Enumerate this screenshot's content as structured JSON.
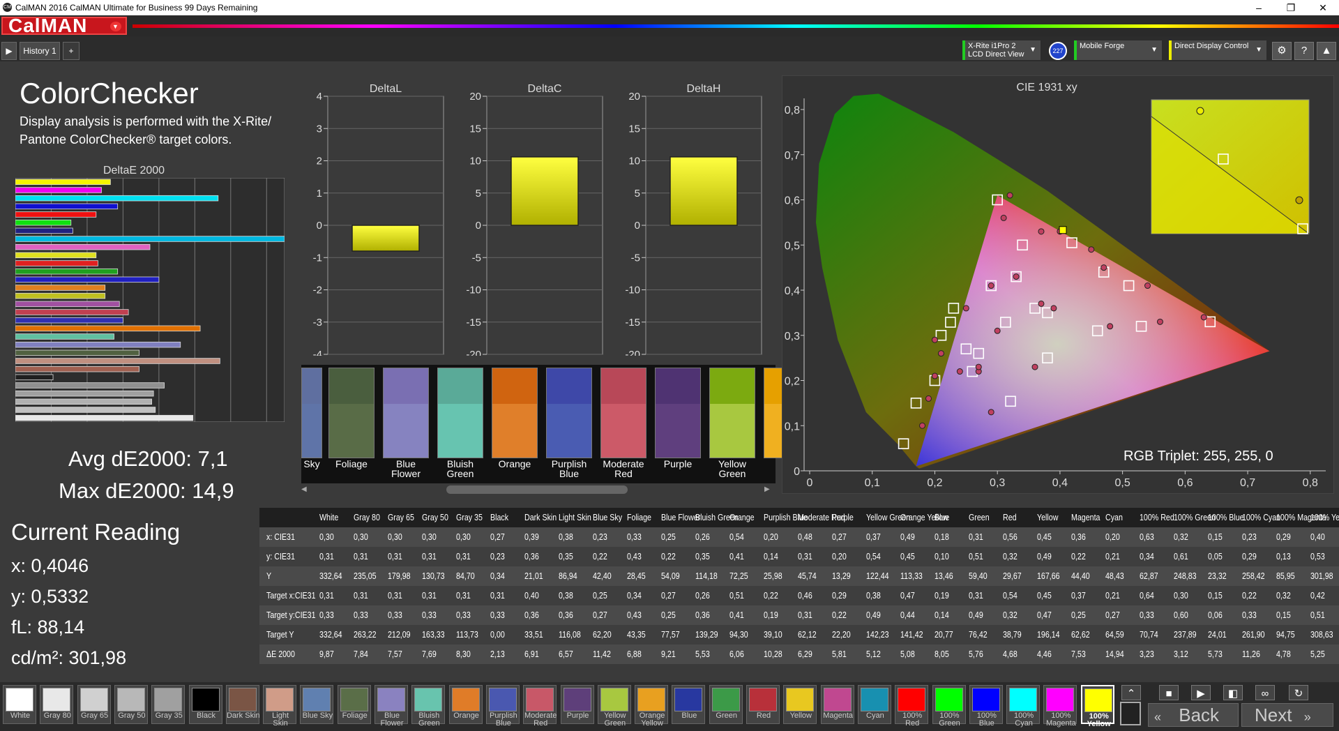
{
  "window": {
    "title": "CalMAN 2016 CalMAN Ultimate for Business 99 Days Remaining",
    "logo": "CM",
    "min": "–",
    "max": "❐",
    "close": "✕"
  },
  "brand": {
    "name": "CalMAN"
  },
  "tabs": [
    {
      "label": "History 1"
    },
    {
      "label": "+"
    }
  ],
  "devices": {
    "meter": "X-Rite i1Pro 2",
    "meter_mode": "LCD Direct View",
    "meter_badge": "227",
    "source": "Mobile Forge",
    "display": "Direct Display Control"
  },
  "colorchecker": {
    "title": "ColorChecker",
    "desc1": "Display analysis is performed with the X-Rite/",
    "desc2": "Pantone ColorChecker® target colors.",
    "chart_title": "DeltaE 2000",
    "avg": "Avg dE2000: 7,1",
    "max": "Max dE2000: 14,9"
  },
  "current": {
    "title": "Current Reading",
    "x": "x: 0,4046",
    "y": "y: 0,5332",
    "fL": "fL: 88,14",
    "cdm2": "cd/m²: 301,98"
  },
  "mini_titles": [
    "DeltaL",
    "DeltaC",
    "DeltaH"
  ],
  "cie": {
    "title": "CIE 1931 xy",
    "triplet": "RGB Triplet: 255, 255, 0"
  },
  "navigation": {
    "back": "Back",
    "next": "Next"
  },
  "chart_data": [
    {
      "type": "bar",
      "title": "DeltaE 2000",
      "orientation": "horizontal",
      "xlim": [
        0,
        15
      ],
      "xticks": [
        "0",
        "2",
        "4",
        "6",
        "8",
        "10",
        "12",
        "14"
      ],
      "colors": [
        "#f4f400",
        "#f000f0",
        "#00e0f0",
        "#1010d0",
        "#f01010",
        "#10e010",
        "#202080",
        "#00b8e0",
        "#e060c0",
        "#e0e020",
        "#e02020",
        "#20a020",
        "#2020c0",
        "#e08020",
        "#c0c020",
        "#a050a0",
        "#c04050",
        "#3030b0",
        "#e07000",
        "#60c0a0",
        "#8080c0",
        "#506040",
        "#c09080",
        "#a06050",
        "#202020",
        "#909090",
        "#a0a0a0",
        "#b0b0b0",
        "#c0c0c0",
        "#e8e8e8"
      ],
      "values": [
        5.3,
        4.8,
        11.3,
        5.7,
        4.5,
        3.1,
        3.2,
        15.0,
        7.5,
        4.5,
        4.6,
        5.7,
        8.0,
        5.0,
        5.0,
        5.8,
        6.3,
        6.0,
        10.3,
        5.5,
        9.2,
        6.9,
        11.4,
        6.9,
        2.1,
        8.3,
        7.7,
        7.6,
        7.8,
        9.9
      ]
    },
    {
      "type": "bar",
      "title": "DeltaL",
      "ylim": [
        -4,
        4
      ],
      "yticks": [
        "4",
        "3",
        "2",
        "1",
        "0",
        "-1",
        "-2",
        "-3",
        "-4"
      ],
      "values": [
        -0.8
      ]
    },
    {
      "type": "bar",
      "title": "DeltaC",
      "ylim": [
        -20,
        20
      ],
      "yticks": [
        "20",
        "15",
        "10",
        "5",
        "0",
        "-5",
        "-10",
        "-15",
        "-20"
      ],
      "values": [
        10.6
      ]
    },
    {
      "type": "bar",
      "title": "DeltaH",
      "ylim": [
        -20,
        20
      ],
      "yticks": [
        "20",
        "15",
        "10",
        "5",
        "0",
        "-5",
        "-10",
        "-15",
        "-20"
      ],
      "values": [
        10.6
      ]
    },
    {
      "type": "scatter",
      "title": "CIE 1931 xy",
      "xlim": [
        0,
        0.8
      ],
      "ylim": [
        0,
        0.8
      ],
      "xticks": [
        "0",
        "0,1",
        "0,2",
        "0,3",
        "0,4",
        "0,5",
        "0,6",
        "0,7",
        "0,8"
      ],
      "yticks": [
        "0,8",
        "0,7",
        "0,6",
        "0,5",
        "0,4",
        "0,3",
        "0,2",
        "0,1",
        "0"
      ],
      "gamut": [
        [
          0.64,
          0.33
        ],
        [
          0.3,
          0.6
        ],
        [
          0.15,
          0.06
        ]
      ],
      "targets": [
        [
          0.64,
          0.33
        ],
        [
          0.3,
          0.6
        ],
        [
          0.15,
          0.06
        ],
        [
          0.225,
          0.329
        ],
        [
          0.321,
          0.154
        ],
        [
          0.419,
          0.505
        ],
        [
          0.313,
          0.329
        ],
        [
          0.38,
          0.35
        ],
        [
          0.26,
          0.22
        ],
        [
          0.33,
          0.43
        ],
        [
          0.46,
          0.31
        ],
        [
          0.51,
          0.41
        ],
        [
          0.38,
          0.25
        ],
        [
          0.2,
          0.2
        ],
        [
          0.29,
          0.41
        ],
        [
          0.53,
          0.32
        ],
        [
          0.47,
          0.44
        ],
        [
          0.34,
          0.5
        ],
        [
          0.25,
          0.27
        ],
        [
          0.21,
          0.3
        ],
        [
          0.36,
          0.36
        ],
        [
          0.17,
          0.15
        ],
        [
          0.23,
          0.36
        ],
        [
          0.27,
          0.26
        ]
      ],
      "measured": [
        [
          0.63,
          0.34
        ],
        [
          0.32,
          0.61
        ],
        [
          0.18,
          0.1
        ],
        [
          0.2,
          0.29
        ],
        [
          0.29,
          0.13
        ],
        [
          0.45,
          0.49
        ],
        [
          0.3,
          0.31
        ],
        [
          0.39,
          0.36
        ],
        [
          0.27,
          0.22
        ],
        [
          0.33,
          0.43
        ],
        [
          0.48,
          0.32
        ],
        [
          0.54,
          0.41
        ],
        [
          0.36,
          0.23
        ],
        [
          0.2,
          0.21
        ],
        [
          0.29,
          0.41
        ],
        [
          0.56,
          0.33
        ],
        [
          0.47,
          0.45
        ],
        [
          0.37,
          0.53
        ],
        [
          0.24,
          0.22
        ],
        [
          0.21,
          0.26
        ],
        [
          0.37,
          0.37
        ],
        [
          0.19,
          0.16
        ],
        [
          0.25,
          0.36
        ],
        [
          0.27,
          0.23
        ],
        [
          0.31,
          0.56
        ],
        [
          0.4,
          0.53
        ]
      ],
      "current": [
        0.4046,
        0.5332
      ],
      "inset_targets": [
        [
          0.42,
          0.505
        ]
      ]
    }
  ],
  "swatches": [
    {
      "name": "Sky",
      "top": "#5f6fa0",
      "bottom": "#5f74a8"
    },
    {
      "name": "Foliage",
      "top": "#4a5e3e",
      "bottom": "#596c47"
    },
    {
      "name": "Blue\nFlower",
      "top": "#7a6fb2",
      "bottom": "#8683c0"
    },
    {
      "name": "Bluish\nGreen",
      "top": "#5aaa98",
      "bottom": "#67c4b0"
    },
    {
      "name": "Orange",
      "top": "#d06410",
      "bottom": "#e07f2a"
    },
    {
      "name": "Purplish\nBlue",
      "top": "#3e48a8",
      "bottom": "#4a5cb2"
    },
    {
      "name": "Moderate\nRed",
      "top": "#b84858",
      "bottom": "#cc5a68"
    },
    {
      "name": "Purple",
      "top": "#4f3372",
      "bottom": "#5f3f7e"
    },
    {
      "name": "Yellow\nGreen",
      "top": "#7caa10",
      "bottom": "#a8c840"
    },
    {
      "name": "",
      "top": "#e6a000",
      "bottom": "#f0b020"
    }
  ],
  "table": {
    "headers": [
      "White",
      "Gray 80",
      "Gray 65",
      "Gray 50",
      "Gray 35",
      "Black",
      "Dark Skin",
      "Light Skin",
      "Blue Sky",
      "Foliage",
      "Blue Flower",
      "Bluish Green",
      "Orange",
      "Purplish Blue",
      "Moderate Red",
      "Purple",
      "Yellow Green",
      "Orange Yellow",
      "Blue",
      "Green",
      "Red",
      "Yellow",
      "Magenta",
      "Cyan",
      "100% Red",
      "100% Green",
      "100% Blue",
      "100% Cyan",
      "100% Magenta",
      "100% Yellow"
    ],
    "rows": [
      {
        "label": "x: CIE31",
        "values": [
          "0,30",
          "0,30",
          "0,30",
          "0,30",
          "0,30",
          "0,27",
          "0,39",
          "0,38",
          "0,23",
          "0,33",
          "0,25",
          "0,26",
          "0,54",
          "0,20",
          "0,48",
          "0,27",
          "0,37",
          "0,49",
          "0,18",
          "0,31",
          "0,56",
          "0,45",
          "0,36",
          "0,20",
          "0,63",
          "0,32",
          "0,15",
          "0,23",
          "0,29",
          "0,40"
        ]
      },
      {
        "label": "y: CIE31",
        "values": [
          "0,31",
          "0,31",
          "0,31",
          "0,31",
          "0,31",
          "0,23",
          "0,36",
          "0,35",
          "0,22",
          "0,43",
          "0,22",
          "0,35",
          "0,41",
          "0,14",
          "0,31",
          "0,20",
          "0,54",
          "0,45",
          "0,10",
          "0,51",
          "0,32",
          "0,49",
          "0,22",
          "0,21",
          "0,34",
          "0,61",
          "0,05",
          "0,29",
          "0,13",
          "0,53"
        ]
      },
      {
        "label": "Y",
        "values": [
          "332,64",
          "235,05",
          "179,98",
          "130,73",
          "84,70",
          "0,34",
          "21,01",
          "86,94",
          "42,40",
          "28,45",
          "54,09",
          "114,18",
          "72,25",
          "25,98",
          "45,74",
          "13,29",
          "122,44",
          "113,33",
          "13,46",
          "59,40",
          "29,67",
          "167,66",
          "44,40",
          "48,43",
          "62,87",
          "248,83",
          "23,32",
          "258,42",
          "85,95",
          "301,98"
        ]
      },
      {
        "label": "Target x:CIE31",
        "values": [
          "0,31",
          "0,31",
          "0,31",
          "0,31",
          "0,31",
          "0,31",
          "0,40",
          "0,38",
          "0,25",
          "0,34",
          "0,27",
          "0,26",
          "0,51",
          "0,22",
          "0,46",
          "0,29",
          "0,38",
          "0,47",
          "0,19",
          "0,31",
          "0,54",
          "0,45",
          "0,37",
          "0,21",
          "0,64",
          "0,30",
          "0,15",
          "0,22",
          "0,32",
          "0,42"
        ]
      },
      {
        "label": "Target y:CIE31",
        "values": [
          "0,33",
          "0,33",
          "0,33",
          "0,33",
          "0,33",
          "0,33",
          "0,36",
          "0,36",
          "0,27",
          "0,43",
          "0,25",
          "0,36",
          "0,41",
          "0,19",
          "0,31",
          "0,22",
          "0,49",
          "0,44",
          "0,14",
          "0,49",
          "0,32",
          "0,47",
          "0,25",
          "0,27",
          "0,33",
          "0,60",
          "0,06",
          "0,33",
          "0,15",
          "0,51"
        ]
      },
      {
        "label": "Target Y",
        "values": [
          "332,64",
          "263,22",
          "212,09",
          "163,33",
          "113,73",
          "0,00",
          "33,51",
          "116,08",
          "62,20",
          "43,35",
          "77,57",
          "139,29",
          "94,30",
          "39,10",
          "62,12",
          "22,20",
          "142,23",
          "141,42",
          "20,77",
          "76,42",
          "38,79",
          "196,14",
          "62,62",
          "64,59",
          "70,74",
          "237,89",
          "24,01",
          "261,90",
          "94,75",
          "308,63"
        ]
      },
      {
        "label": "ΔE 2000",
        "values": [
          "9,87",
          "7,84",
          "7,57",
          "7,69",
          "8,30",
          "2,13",
          "6,91",
          "6,57",
          "11,42",
          "6,88",
          "9,21",
          "5,53",
          "6,06",
          "10,28",
          "6,29",
          "5,81",
          "5,12",
          "5,08",
          "8,05",
          "5,76",
          "4,68",
          "4,46",
          "7,53",
          "14,94",
          "3,23",
          "3,12",
          "5,73",
          "11,26",
          "4,78",
          "5,25"
        ]
      }
    ]
  },
  "bottom_swatches": [
    {
      "label": "White",
      "color": "#ffffff"
    },
    {
      "label": "Gray 80",
      "color": "#e8e8e8"
    },
    {
      "label": "Gray 65",
      "color": "#d0d0d0"
    },
    {
      "label": "Gray 50",
      "color": "#b8b8b8"
    },
    {
      "label": "Gray 35",
      "color": "#a0a0a0"
    },
    {
      "label": "Black",
      "color": "#000000"
    },
    {
      "label": "Dark Skin",
      "color": "#7a5545"
    },
    {
      "label": "Light Skin",
      "color": "#d09c88"
    },
    {
      "label": "Blue Sky",
      "color": "#6080b0"
    },
    {
      "label": "Foliage",
      "color": "#5a6e48"
    },
    {
      "label": "Blue\nFlower",
      "color": "#8a82c0"
    },
    {
      "label": "Bluish\nGreen",
      "color": "#68c4ae"
    },
    {
      "label": "Orange",
      "color": "#e07c28"
    },
    {
      "label": "Purplish\nBlue",
      "color": "#4a58b0"
    },
    {
      "label": "Moderate\nRed",
      "color": "#c85868"
    },
    {
      "label": "Purple",
      "color": "#5e3f7a"
    },
    {
      "label": "Yellow\nGreen",
      "color": "#a8c840"
    },
    {
      "label": "Orange\nYellow",
      "color": "#e8a020"
    },
    {
      "label": "Blue",
      "color": "#2838a0"
    },
    {
      "label": "Green",
      "color": "#3c9a48"
    },
    {
      "label": "Red",
      "color": "#b8303a"
    },
    {
      "label": "Yellow",
      "color": "#e8c820"
    },
    {
      "label": "Magenta",
      "color": "#c04890"
    },
    {
      "label": "Cyan",
      "color": "#1890b0"
    },
    {
      "label": "100% Red",
      "color": "#ff0000"
    },
    {
      "label": "100%\nGreen",
      "color": "#00ff00"
    },
    {
      "label": "100%\nBlue",
      "color": "#0000ff"
    },
    {
      "label": "100%\nCyan",
      "color": "#00ffff"
    },
    {
      "label": "100%\nMagenta",
      "color": "#ff00ff"
    },
    {
      "label": "100%\nYellow",
      "color": "#ffff00"
    }
  ]
}
